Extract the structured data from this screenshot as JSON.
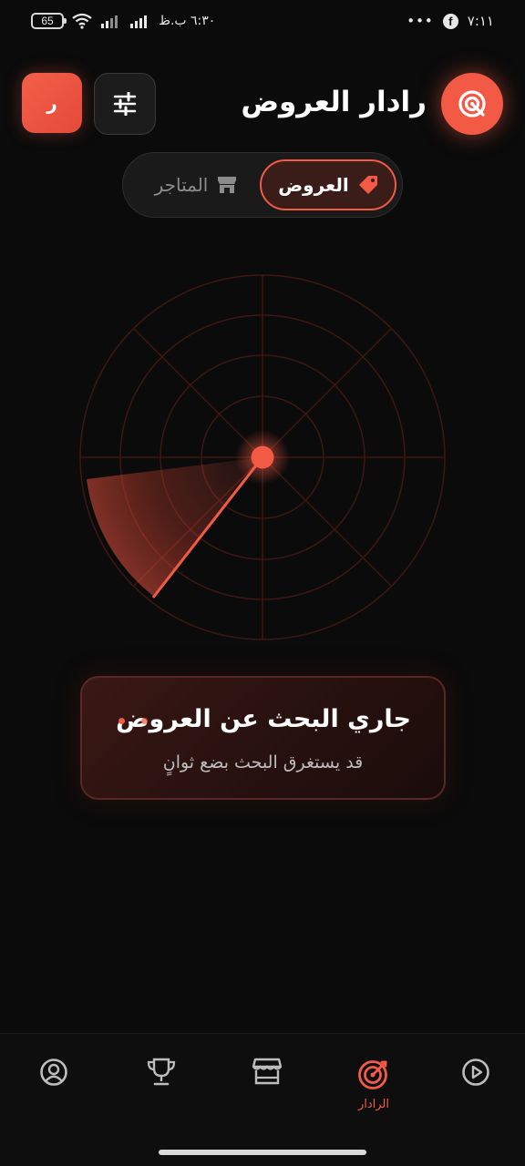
{
  "status_bar": {
    "battery": "65",
    "time_left": "٦:٣٠ ب.ظ",
    "time_right": "٧:١١",
    "more": "•••",
    "fb_letter": "f"
  },
  "header": {
    "title": "رادار العروض",
    "user_initial": "ر",
    "logo_icon": "radar-target-icon",
    "filter_icon": "sliders-icon"
  },
  "tabs": [
    {
      "label": "العروض",
      "icon": "tag-icon",
      "active": true
    },
    {
      "label": "المتاجر",
      "icon": "store-icon",
      "active": false
    }
  ],
  "status": {
    "title": "جاري البحث عن العروض",
    "subtitle": "قد يستغرق البحث بضع ثوانٍ"
  },
  "nav": {
    "items": [
      {
        "icon": "play-circle-icon",
        "active": false
      },
      {
        "icon": "radar-icon",
        "label": "الرادار",
        "active": true
      },
      {
        "icon": "store-icon",
        "active": false
      },
      {
        "icon": "trophy-icon",
        "active": false
      },
      {
        "icon": "user-circle-icon",
        "active": false
      }
    ]
  },
  "colors": {
    "accent": "#f25a46",
    "background": "#0b0b0b",
    "card": "#2a1210",
    "inactive": "#8c8c8c"
  }
}
